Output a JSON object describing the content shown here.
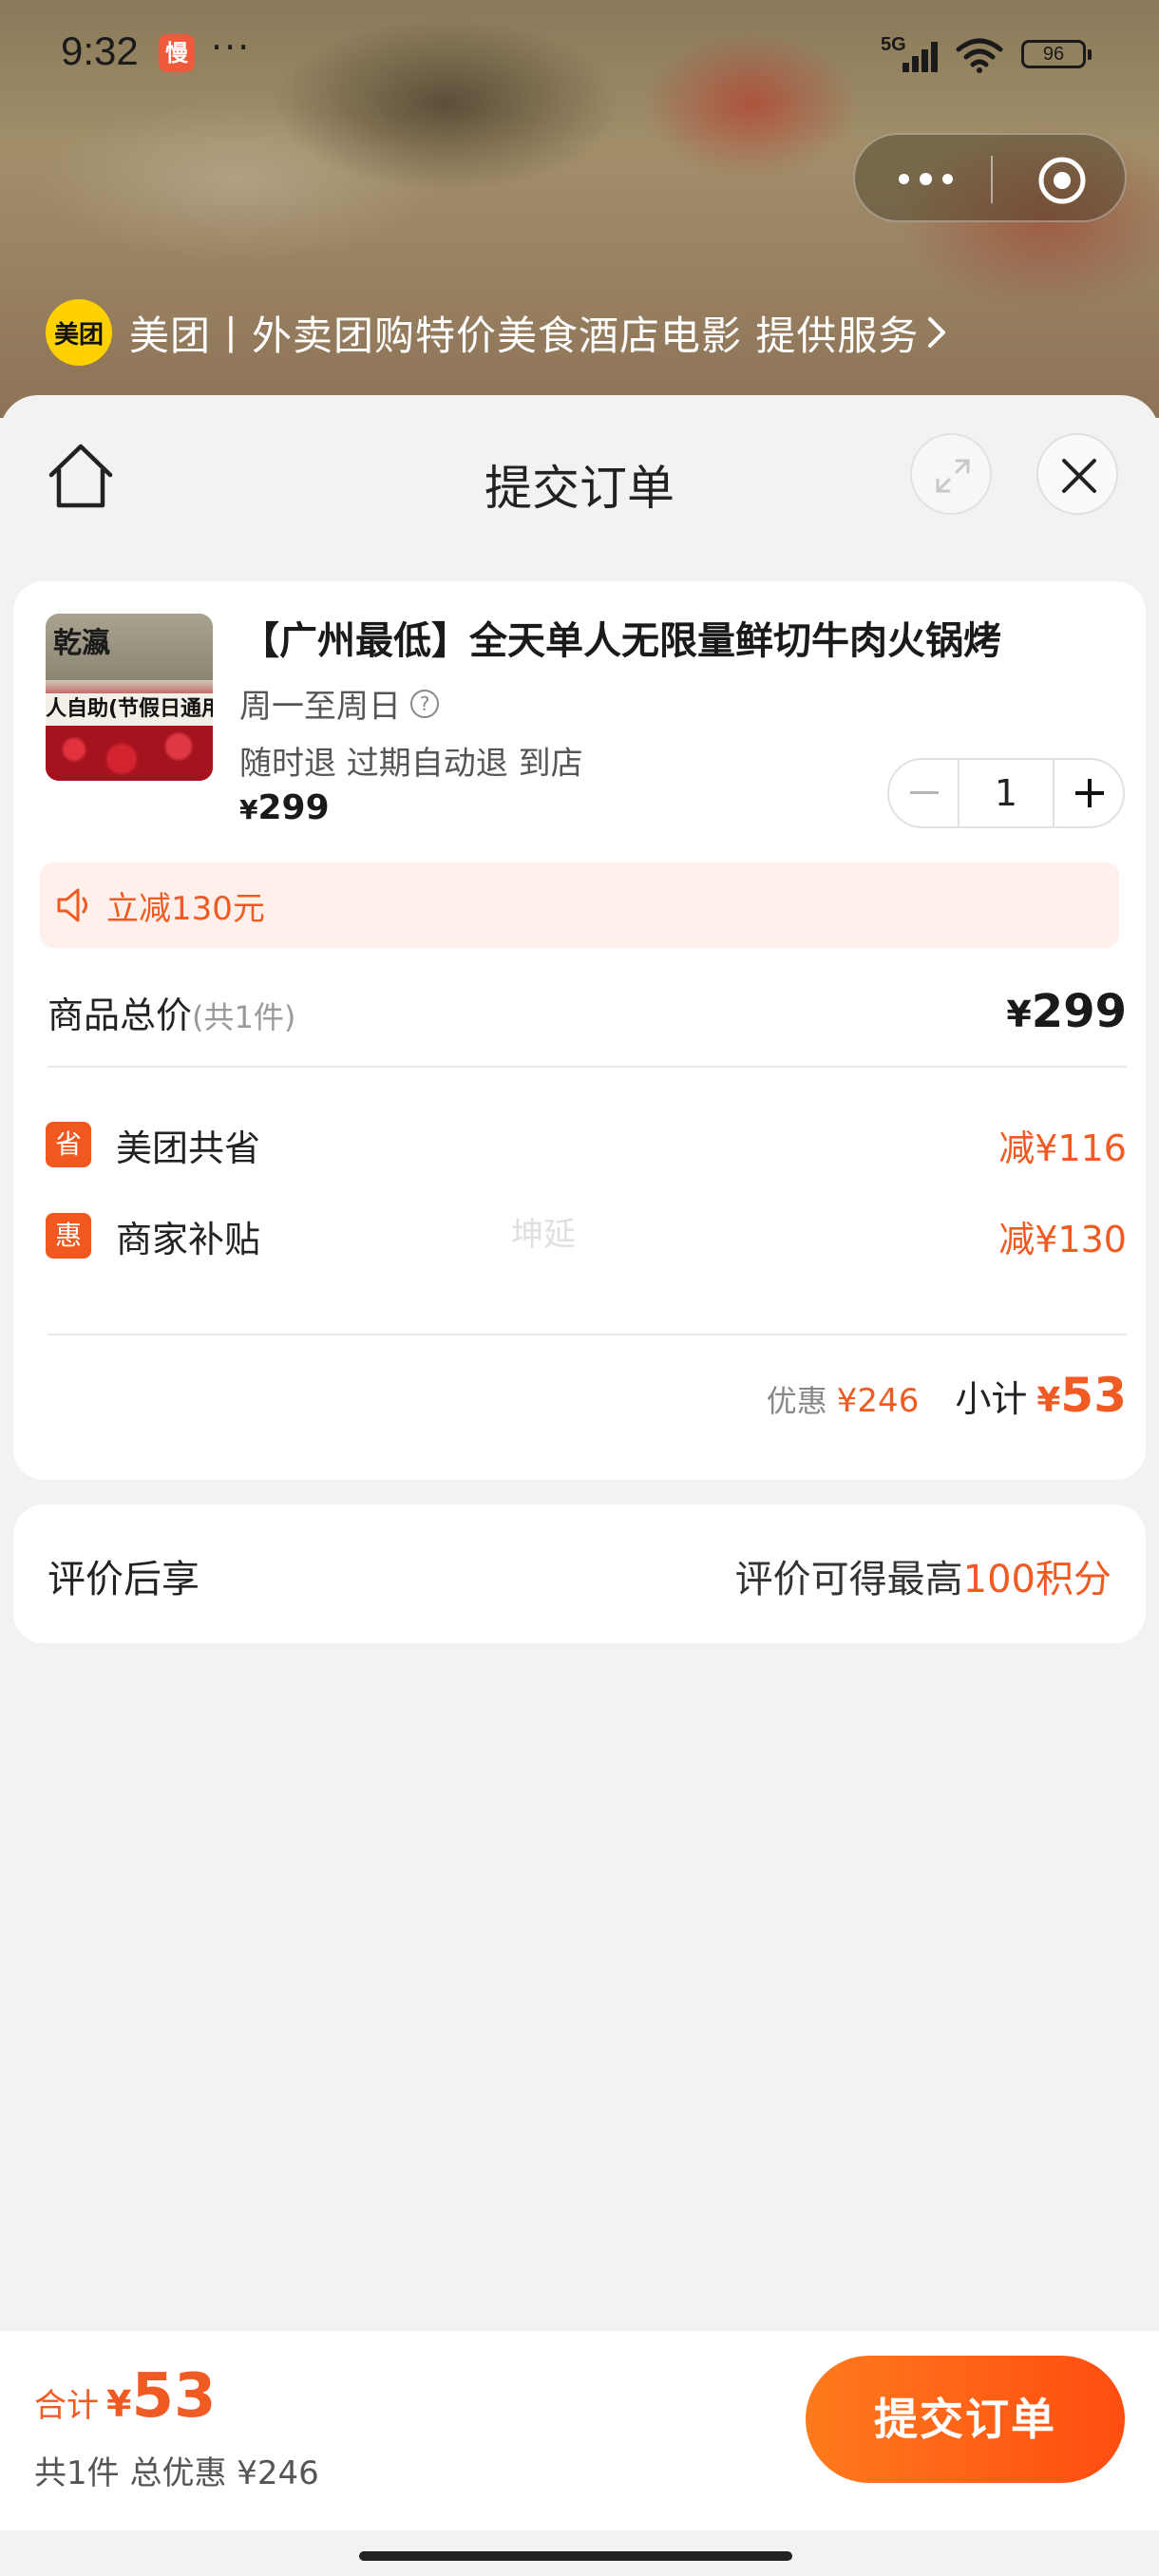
{
  "status_bar": {
    "time": "9:32",
    "app_badge": "慢",
    "network": "5G",
    "battery": "96"
  },
  "provider": {
    "logo_text": "美团",
    "text": "美团丨外卖团购特价美食酒店电影 提供服务"
  },
  "header": {
    "title": "提交订单"
  },
  "product": {
    "thumb_brand": "乾瀛",
    "thumb_band": "人自助(节假日通用",
    "title": "【广州最低】全天单人无限量鲜切牛肉火锅烤",
    "days": "周一至周日",
    "tags": "随时退 过期自动退 到店",
    "price_symbol": "¥",
    "price": "299",
    "quantity": "1"
  },
  "promo": {
    "text": "立减130元"
  },
  "summary": {
    "total_label": "商品总价",
    "total_count": "(共1件)",
    "total_symbol": "¥",
    "total_value": "299",
    "discounts": [
      {
        "tag": "省",
        "label": "美团共省",
        "value": "减¥116"
      },
      {
        "tag": "惠",
        "label": "商家补贴",
        "value": "减¥130"
      }
    ],
    "watermark": "坤延",
    "discount_label": "优惠",
    "discount_value": "¥246",
    "subtotal_label": "小计",
    "subtotal_symbol": "¥",
    "subtotal_value": "53"
  },
  "review": {
    "left": "评价后享",
    "right_prefix": "评价可得最高",
    "right_highlight": "100积分"
  },
  "bottom": {
    "total_label": "合计",
    "total_symbol": "¥",
    "total_value": "53",
    "sub": "共1件 总优惠 ¥246",
    "submit_label": "提交订单"
  },
  "colors": {
    "accent": "#f05a23",
    "button_gradient_start": "#ff7a1c",
    "button_gradient_end": "#ff4d12",
    "promo_bg": "#fff0eb",
    "meituan_yellow": "#ffd100"
  },
  "icons": {
    "home": "home-icon",
    "expand": "expand-icon",
    "close": "close-icon",
    "speaker": "speaker-icon",
    "question": "question-icon"
  }
}
